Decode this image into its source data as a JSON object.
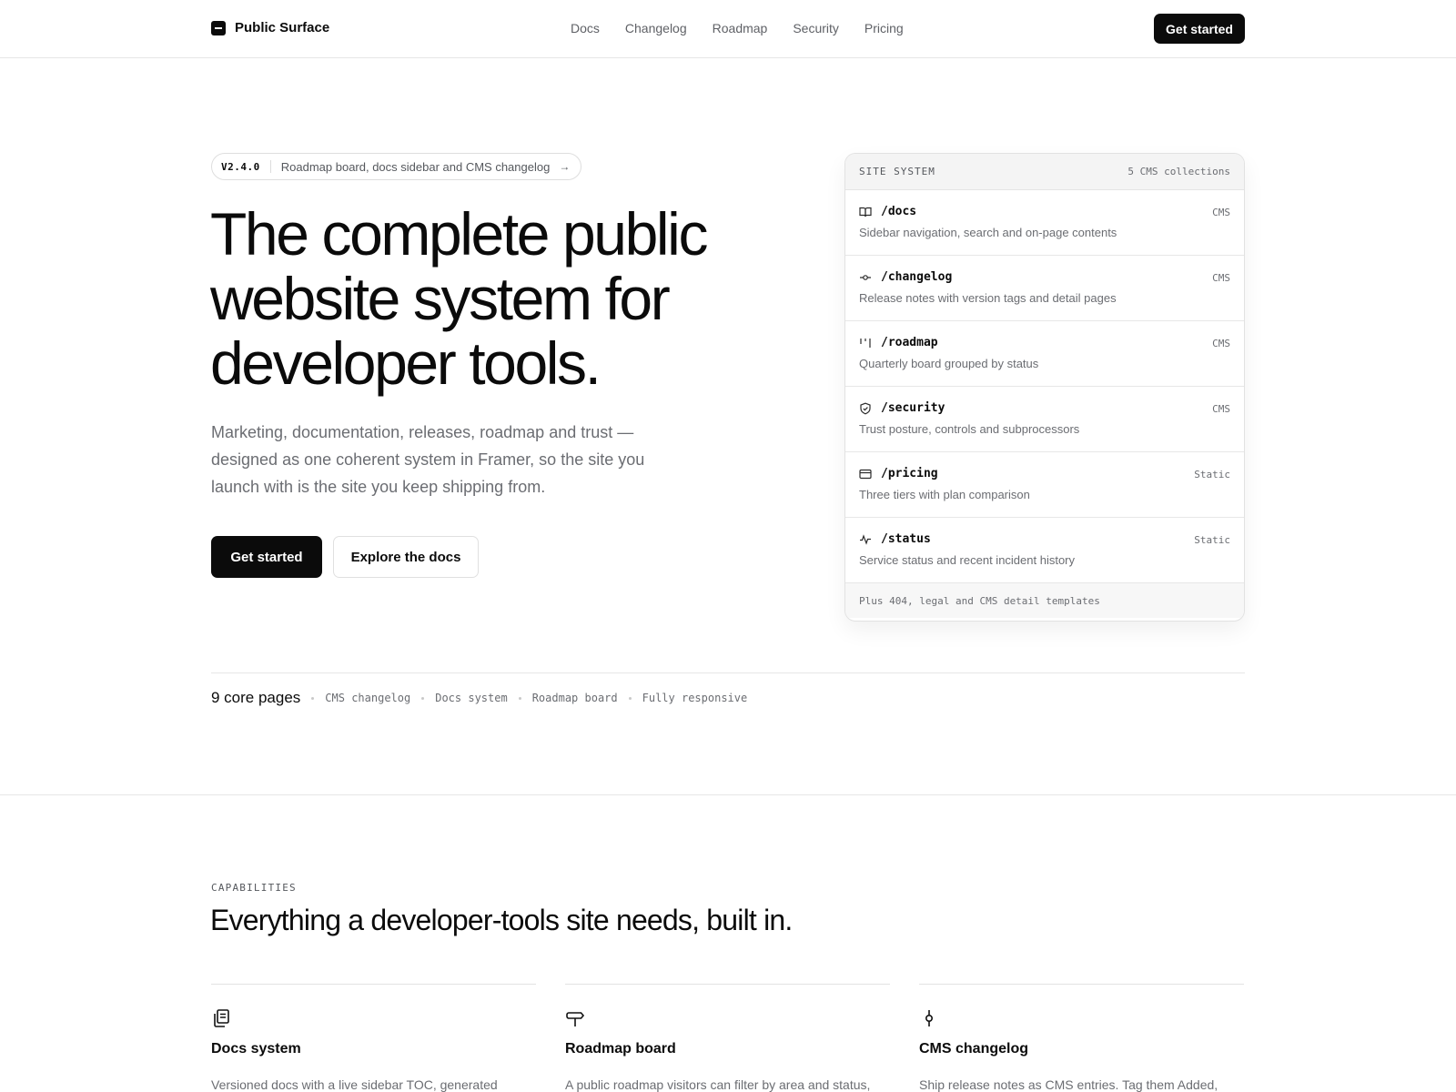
{
  "header": {
    "brand": "Public Surface",
    "nav": [
      "Docs",
      "Changelog",
      "Roadmap",
      "Security",
      "Pricing"
    ],
    "cta": "Get started"
  },
  "hero": {
    "pill_version": "V2.4.0",
    "pill_text": "Roadmap board, docs sidebar and CMS changelog",
    "title": "The complete public website system for developer tools.",
    "subtitle": "Marketing, documentation, releases, roadmap and trust — designed as one coherent system in Framer, so the site you launch with is the site you keep shipping from.",
    "primary_button": "Get started",
    "secondary_button": "Explore the docs"
  },
  "site_system": {
    "title": "SITE SYSTEM",
    "meta": "5 CMS collections",
    "rows": [
      {
        "icon": "book-icon",
        "path": "/docs",
        "tag": "CMS",
        "desc": "Sidebar navigation, search and on-page contents"
      },
      {
        "icon": "commit-icon",
        "path": "/changelog",
        "tag": "CMS",
        "desc": "Release notes with version tags and detail pages"
      },
      {
        "icon": "columns-icon",
        "path": "/roadmap",
        "tag": "CMS",
        "desc": "Quarterly board grouped by status"
      },
      {
        "icon": "shield-icon",
        "path": "/security",
        "tag": "CMS",
        "desc": "Trust posture, controls and subprocessors"
      },
      {
        "icon": "card-icon",
        "path": "/pricing",
        "tag": "Static",
        "desc": "Three tiers with plan comparison"
      },
      {
        "icon": "pulse-icon",
        "path": "/status",
        "tag": "Static",
        "desc": "Service status and recent incident history"
      }
    ],
    "footer": "Plus 404, legal and CMS detail templates"
  },
  "stats": {
    "count": "9 core pages",
    "items": [
      "CMS changelog",
      "Docs system",
      "Roadmap board",
      "Fully responsive"
    ]
  },
  "capabilities": {
    "eyebrow": "CAPABILITIES",
    "title": "Everything a developer-tools site needs, built in.",
    "features": [
      {
        "icon": "copy-pages-icon",
        "title": "Docs system",
        "desc": "Versioned docs with a live sidebar TOC, generated"
      },
      {
        "icon": "signpost-icon",
        "title": "Roadmap board",
        "desc": "A public roadmap visitors can filter by area and status,"
      },
      {
        "icon": "git-commit-icon",
        "title": "CMS changelog",
        "desc": "Ship release notes as CMS entries. Tag them Added,"
      }
    ]
  }
}
